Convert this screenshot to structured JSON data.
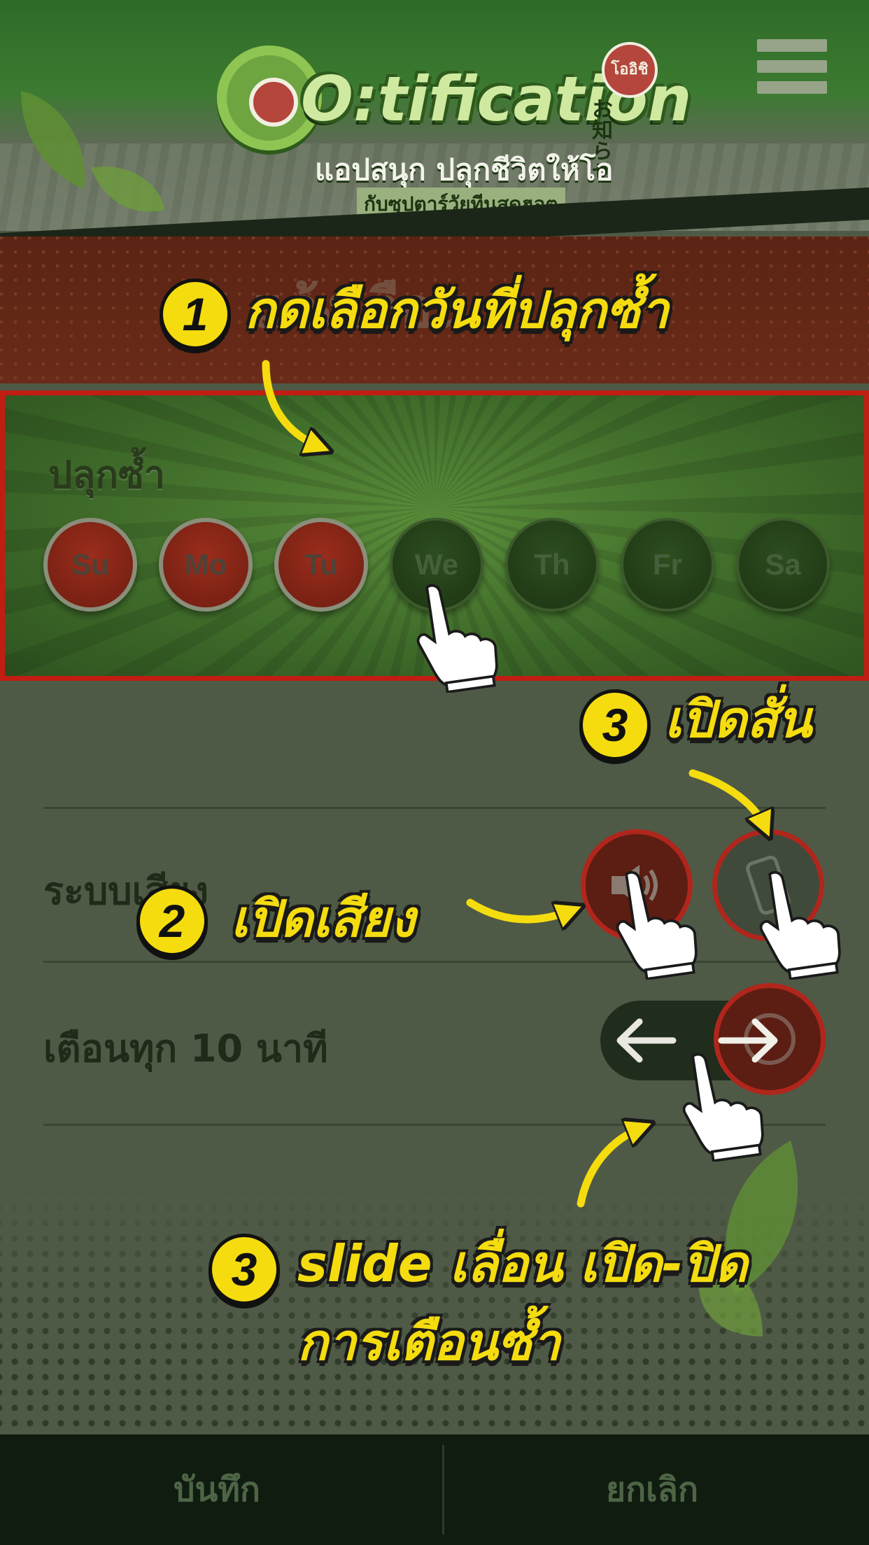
{
  "header": {
    "logo_title": "O:tification",
    "logo_tagline": "แอปสนุก ปลุกชีวิตให้โอ",
    "logo_subtagline": "กับซุปตาร์วัยทีนสุดฮอต",
    "logo_brand": "โออิชิ",
    "logo_side_text": "お知らせ"
  },
  "banner": {
    "title": "แจ้งเตือน"
  },
  "repeat": {
    "label": "ปลุกซ้ำ",
    "days": [
      {
        "label": "Su",
        "selected": true
      },
      {
        "label": "Mo",
        "selected": true
      },
      {
        "label": "Tu",
        "selected": true
      },
      {
        "label": "We",
        "selected": false
      },
      {
        "label": "Th",
        "selected": false
      },
      {
        "label": "Fr",
        "selected": false
      },
      {
        "label": "Sa",
        "selected": false
      }
    ]
  },
  "settings": {
    "sound_label": "ระบบเสียง",
    "snooze_label": "เตือนทุก 10 นาที",
    "sound_icon": "speaker-icon",
    "vibrate_icon": "phone-vibrate-icon",
    "snooze_icon": "clock-icon"
  },
  "bottom_bar": {
    "save_label": "บันทึก",
    "cancel_label": "ยกเลิก"
  },
  "tutorial": {
    "step1_number": "1",
    "step1_text": "กดเลือกวันที่ปลุกซ้ำ",
    "step2_number": "2",
    "step2_text": "เปิดเสียง",
    "step3a_number": "3",
    "step3a_text": "เปิดสั่น",
    "step3b_number": "3",
    "step3b_line1": "slide เลื่อน เปิด-ปิด",
    "step3b_line2": "การเตือนซ้ำ"
  },
  "colors": {
    "accent_yellow": "#f5dc0f",
    "selected_red": "#8a2416",
    "highlight_border": "#c21d12",
    "panel_green": "#3f6c2a"
  }
}
